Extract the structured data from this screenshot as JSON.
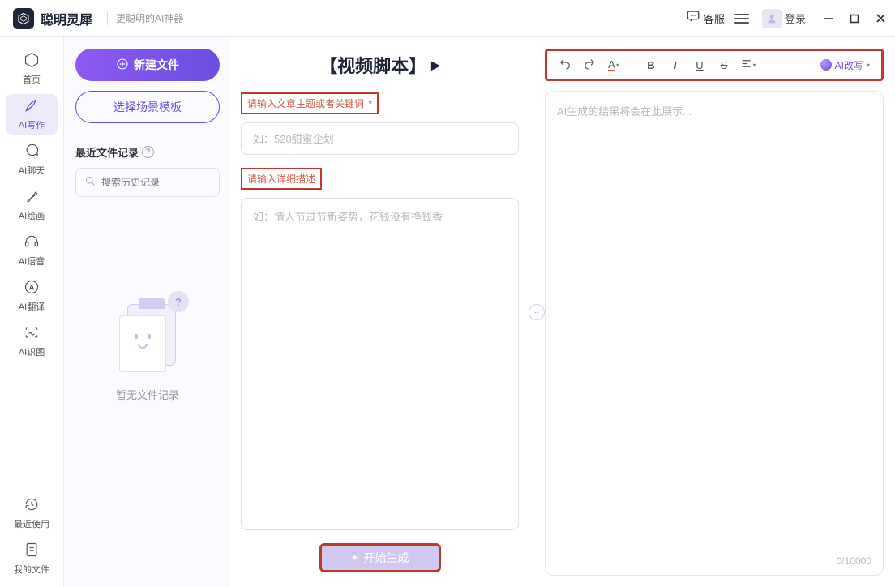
{
  "titlebar": {
    "brand": "聪明灵犀",
    "slogan": "更聪明的AI神器",
    "kefu_label": "客服",
    "login_label": "登录"
  },
  "sidebar": {
    "items": [
      {
        "icon": "home",
        "label": "首页"
      },
      {
        "icon": "pen",
        "label": "AI写作"
      },
      {
        "icon": "chat",
        "label": "AI聊天"
      },
      {
        "icon": "brush",
        "label": "AI绘画"
      },
      {
        "icon": "audio",
        "label": "AI语音"
      },
      {
        "icon": "translate",
        "label": "AI翻译"
      },
      {
        "icon": "image",
        "label": "AI识图"
      }
    ],
    "bottom": [
      {
        "icon": "recent",
        "label": "最近使用"
      },
      {
        "icon": "myfiles",
        "label": "我的文件"
      }
    ]
  },
  "filecol": {
    "new_label": "新建文件",
    "template_label": "选择场景模板",
    "recent_title": "最近文件记录",
    "search_placeholder": "搜索历史记录",
    "empty_label": "暂无文件记录"
  },
  "composer": {
    "title": "【视频脚本】",
    "field_topic_label": "请输入文章主题或者关键词",
    "field_topic_required": "*",
    "field_topic_placeholder": "如：520甜蜜企划",
    "field_desc_label": "请输入详细描述",
    "field_desc_placeholder": "如：情人节过节新姿势，花钱没有挣钱香",
    "generate_label": "开始生成"
  },
  "result": {
    "placeholder": "AI生成的结果将会在此展示...",
    "counter": "0/10000",
    "ai_rewrite_label": "AI改写"
  }
}
